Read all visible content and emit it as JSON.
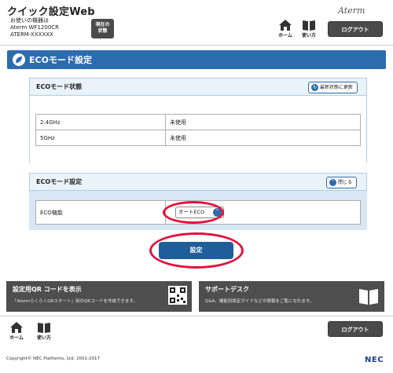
{
  "header": {
    "app_title": "クイック設定Web",
    "device_label": "お使いの機器は",
    "device_model": "Aterm WF1200CR",
    "device_id": "ATERM-XXXXXX",
    "status_button_line1": "現在の",
    "status_button_line2": "状態",
    "brand": "Aterm",
    "home_label": "ホーム",
    "guide_label": "使い方",
    "logout_label": "ログアウト"
  },
  "page": {
    "title": "ECOモード設定",
    "title_icon": "leaf-icon"
  },
  "eco_status": {
    "heading": "ECOモード状態",
    "refresh_label": "最新状態に更新",
    "rows": [
      {
        "band": "2.4GHz",
        "status": "未使用"
      },
      {
        "band": "5GHz",
        "status": "未使用"
      }
    ]
  },
  "eco_settings": {
    "heading": "ECOモード設定",
    "close_label": "閉じる",
    "function_label": "ECO機能",
    "function_value": "オートECO"
  },
  "save_label": "設定",
  "cards": {
    "qr": {
      "title": "設定用QR コードを表示",
      "desc": "「AtermらくらくQRスタート」用のQRコードを作成できます。",
      "icon": "qr-code-icon"
    },
    "support": {
      "title": "サポートデスク",
      "desc": "Q&A、機能別設定ガイドなどの情報をご覧になれます。",
      "icon": "book-icon"
    }
  },
  "footer": {
    "home_label": "ホーム",
    "guide_label": "使い方",
    "logout_label": "ログアウト",
    "copyright": "Copyright© NEC Platforms, Ltd. 2001-2017",
    "corp_logo": "NEC"
  },
  "colors": {
    "accent": "#2d6cae",
    "panel": "#d9e7f4",
    "annotation": "#e4123c",
    "dark_button": "#4a4a4a"
  }
}
